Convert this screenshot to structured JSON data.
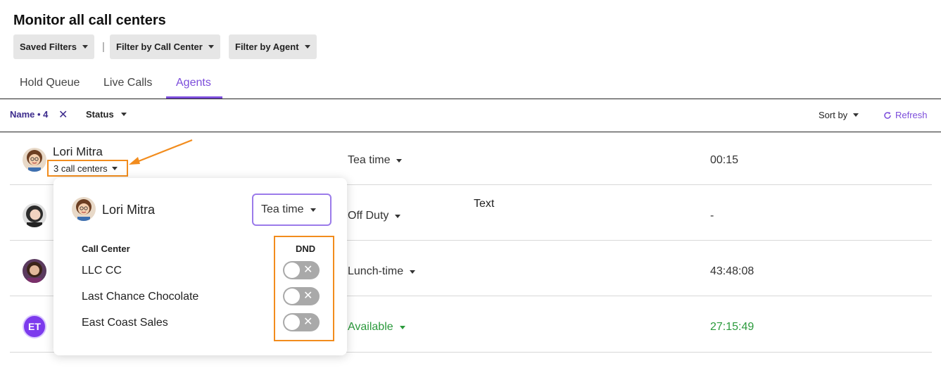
{
  "page": {
    "title": "Monitor all call centers"
  },
  "filters": {
    "saved_filters": "Saved Filters",
    "call_center": "Filter by Call Center",
    "agent": "Filter by Agent",
    "separator": "|"
  },
  "tabs": [
    {
      "label": "Hold Queue",
      "active": false
    },
    {
      "label": "Live Calls",
      "active": false
    },
    {
      "label": "Agents",
      "active": true
    }
  ],
  "toolbar": {
    "name_filter": "Name • 4",
    "status_filter": "Status",
    "sort_by": "Sort by",
    "refresh": "Refresh"
  },
  "agents": [
    {
      "name": "Lori Mitra",
      "call_centers": "3 call centers",
      "status": "Tea time",
      "time": "00:15",
      "status_color": "default"
    },
    {
      "name": "",
      "status": "Off Duty",
      "time": "-",
      "status_color": "default"
    },
    {
      "name": "",
      "status": "Lunch-time",
      "time": "43:48:08",
      "status_color": "default"
    },
    {
      "name": "",
      "initials": "ET",
      "status": "Available",
      "time": "27:15:49",
      "status_color": "#2b9a3c"
    }
  ],
  "floating_text": "Text",
  "popover": {
    "agent_name": "Lori Mitra",
    "status": "Tea time",
    "header_call_center": "Call Center",
    "header_dnd": "DND",
    "call_centers": [
      {
        "name": "LLC CC",
        "dnd": false
      },
      {
        "name": "Last Chance Chocolate",
        "dnd": false
      },
      {
        "name": "East Coast Sales",
        "dnd": false
      }
    ]
  },
  "colors": {
    "accent": "#7c4ddb",
    "highlight": "#f28c1d",
    "available": "#2b9a3c"
  }
}
